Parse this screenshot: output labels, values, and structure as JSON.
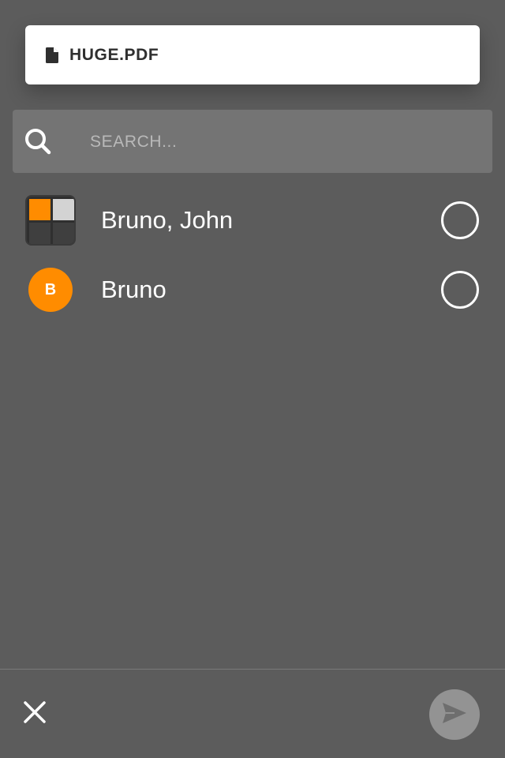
{
  "attachment": {
    "file_name": "HUGE.PDF",
    "icon": "file-icon"
  },
  "search": {
    "placeholder": "SEARCH...",
    "value": "",
    "icon": "search-icon"
  },
  "contacts": [
    {
      "name": "Bruno, John",
      "avatar_type": "group",
      "selected": false
    },
    {
      "name": "Bruno",
      "avatar_type": "initial",
      "initial": "B",
      "avatar_color": "#ff8c00",
      "selected": false
    }
  ],
  "bottom_bar": {
    "close_icon": "close-icon",
    "send_icon": "send-icon"
  },
  "colors": {
    "background": "#5c5c5c",
    "accent": "#ff8c00",
    "search_bg": "#747474",
    "send_button_disabled": "#939393"
  }
}
